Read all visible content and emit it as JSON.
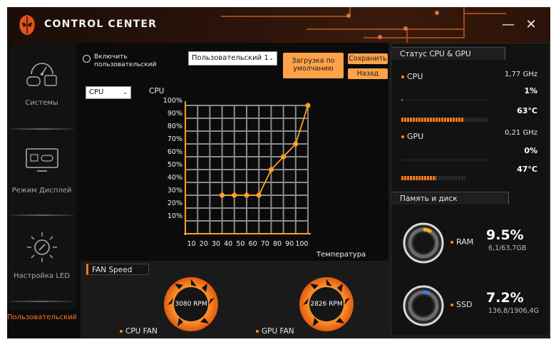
{
  "app": {
    "title": "CONTROL CENTER"
  },
  "window_controls": {
    "minimize": "—",
    "close": "✕"
  },
  "sidebar": {
    "items": [
      {
        "label": "Системы",
        "icon": "gauge-icon"
      },
      {
        "label": "Режим Дисплей",
        "icon": "monitor-gamepad-icon"
      },
      {
        "label": "Настройка LED",
        "icon": "led-bulb-icon"
      }
    ],
    "active_label": "Пользовательский"
  },
  "controls": {
    "enable_custom_line1": "Включить",
    "enable_custom_line2": "пользовательский",
    "profile_select": "Пользовательский 1",
    "load_default_line1": "Загрузка по",
    "load_default_line2": "умолчанию",
    "save": "Сохранить",
    "back": "Назад",
    "target_select": "CPU"
  },
  "accent_color": "#ff7a1a",
  "chart_data": {
    "type": "line",
    "title": "CPU",
    "xlabel": "Температура",
    "ylabel": "",
    "x": [
      10,
      20,
      30,
      40,
      50,
      60,
      70,
      80,
      90,
      100
    ],
    "y_ticks": [
      "100%",
      "90%",
      "80%",
      "70%",
      "60%",
      "50%",
      "40%",
      "30%",
      "20%",
      "10%"
    ],
    "series": [
      {
        "points": [
          [
            30,
            30
          ],
          [
            40,
            30
          ],
          [
            50,
            30
          ],
          [
            60,
            30
          ],
          [
            70,
            50
          ],
          [
            80,
            60
          ],
          [
            90,
            70
          ],
          [
            100,
            100
          ]
        ]
      }
    ],
    "xlim": [
      0,
      100
    ],
    "ylim": [
      0,
      100
    ],
    "grid": true,
    "color": "#ffa020"
  },
  "fan": {
    "title": "FAN Speed",
    "cpu": {
      "label": "CPU FAN",
      "rpm": "3080 RPM"
    },
    "gpu": {
      "label": "GPU FAN",
      "rpm": "2826 RPM"
    }
  },
  "status": {
    "title": "Статус CPU & GPU",
    "cpu": {
      "label": "CPU",
      "clock": "1,77 GHz",
      "load": "1%",
      "temp": "63°C",
      "load_fraction": 0.01,
      "temp_fraction": 0.72
    },
    "gpu": {
      "label": "GPU",
      "clock": "0,21 GHz",
      "load": "0%",
      "temp": "47°C",
      "load_fraction": 0.0,
      "temp_fraction": 0.54
    }
  },
  "memory": {
    "title": "Память и диск",
    "ram": {
      "label": "RAM",
      "percent": "9.5%",
      "detail": "6,1/63,7GB",
      "fraction": 0.095
    },
    "ssd": {
      "label": "SSD",
      "percent": "7.2%",
      "detail": "136,8/1906,4G",
      "fraction": 0.072
    }
  }
}
